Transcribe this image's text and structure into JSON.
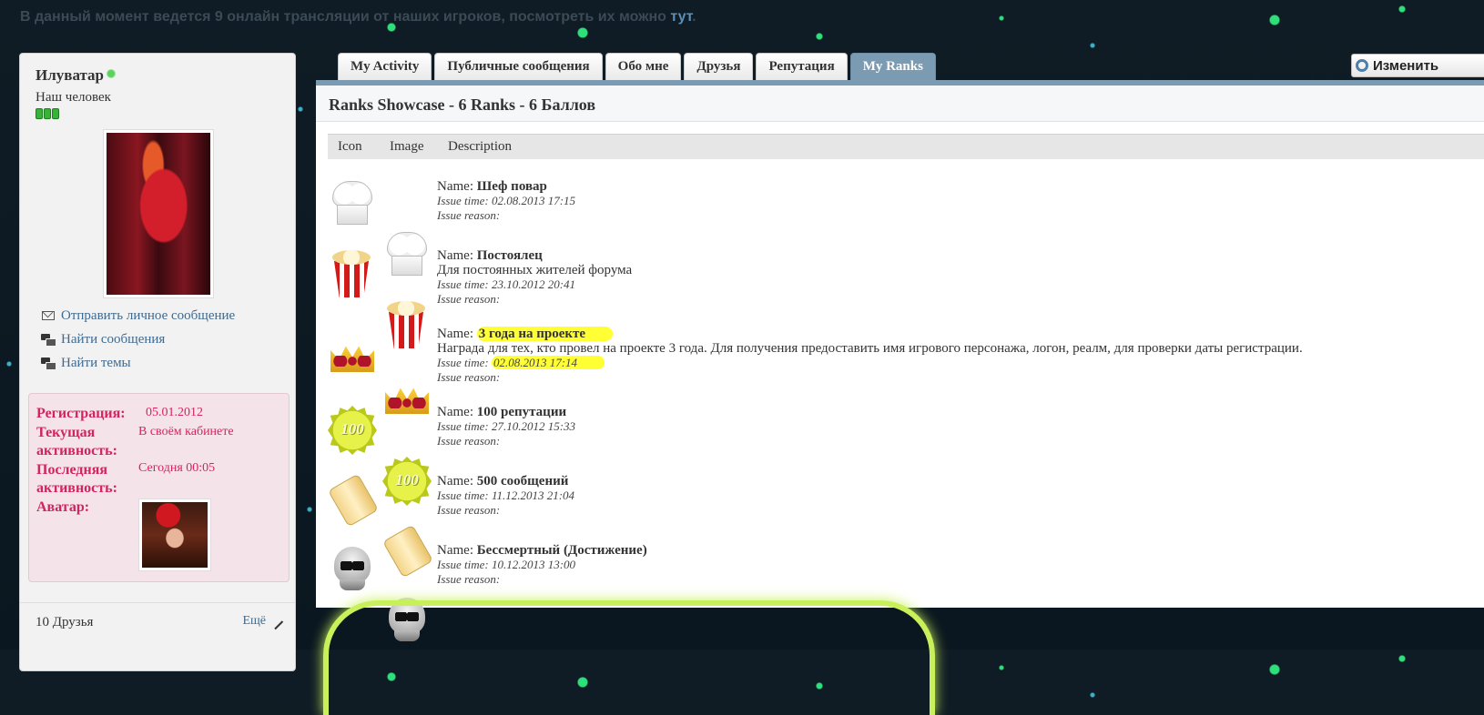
{
  "notice": {
    "text": "В данный момент ведется 9 онлайн трансляции от наших игроков, посмотреть их можно ",
    "link": "тут",
    "suffix": "."
  },
  "profile": {
    "username": "Илуватар",
    "title": "Наш человек",
    "links": [
      {
        "label": "Отправить личное сообщение",
        "icon": "envelope-icon"
      },
      {
        "label": "Найти сообщения",
        "icon": "chat-bubbles-icon"
      },
      {
        "label": "Найти темы",
        "icon": "chat-bubbles-icon"
      }
    ],
    "info": {
      "reg_label": "Регистрация:",
      "reg_value": "05.01.2012",
      "cur_label1": "Текущая",
      "cur_label2": "активность:",
      "cur_value": "В своём кабинете",
      "last_label1": "Последняя",
      "last_label2": "активность:",
      "last_value": "Сегодня 00:05",
      "avatar_label": "Аватар:"
    },
    "friends": {
      "title": "10 Друзья",
      "more": "Ещё"
    }
  },
  "tabs": [
    {
      "label": "My Activity",
      "active": false
    },
    {
      "label": "Публичные сообщения",
      "active": false
    },
    {
      "label": "Обо мне",
      "active": false
    },
    {
      "label": "Друзья",
      "active": false
    },
    {
      "label": "Репутация",
      "active": false
    },
    {
      "label": "My Ranks",
      "active": true
    }
  ],
  "edit_button": "Изменить",
  "panel": {
    "title": "Ranks Showcase - 6 Ranks - 6 Баллов",
    "columns": [
      "Icon",
      "Image",
      "Description"
    ]
  },
  "labels": {
    "name": "Name: ",
    "issue_time": "Issue time: ",
    "issue_reason": "Issue reason:"
  },
  "ranks": [
    {
      "name": "Шеф повар",
      "desc": "",
      "time": "02.08.2013 17:15",
      "icon": "chef-hat-icon"
    },
    {
      "name": "Постоялец",
      "desc": "Для постоянных жителей форума",
      "time": "23.10.2012 20:41",
      "icon": "popcorn-icon"
    },
    {
      "name": "3 года на проекте",
      "desc": "Награда для тех, кто провел на проекте 3 года. Для получения предоставить имя игрового персонажа, логон, реалм, для проверки даты регистрации.",
      "time": "02.08.2013 17:14",
      "icon": "crown-icon"
    },
    {
      "name": "100 репутации",
      "desc": "",
      "time": "27.10.2012 15:33",
      "icon": "seal-100-icon",
      "seal_text": "100"
    },
    {
      "name": "500 сообщений",
      "desc": "",
      "time": "11.12.2013 21:04",
      "icon": "scroll-icon"
    },
    {
      "name": "Бессмертный (Достижение)",
      "desc": "",
      "time": "10.12.2013 13:00",
      "icon": "skull-icon"
    }
  ],
  "colors": {
    "tab_active": "#7b9bb3",
    "info_text": "#d3245f",
    "link": "#3e6a91",
    "highlight": "#ffff33"
  }
}
